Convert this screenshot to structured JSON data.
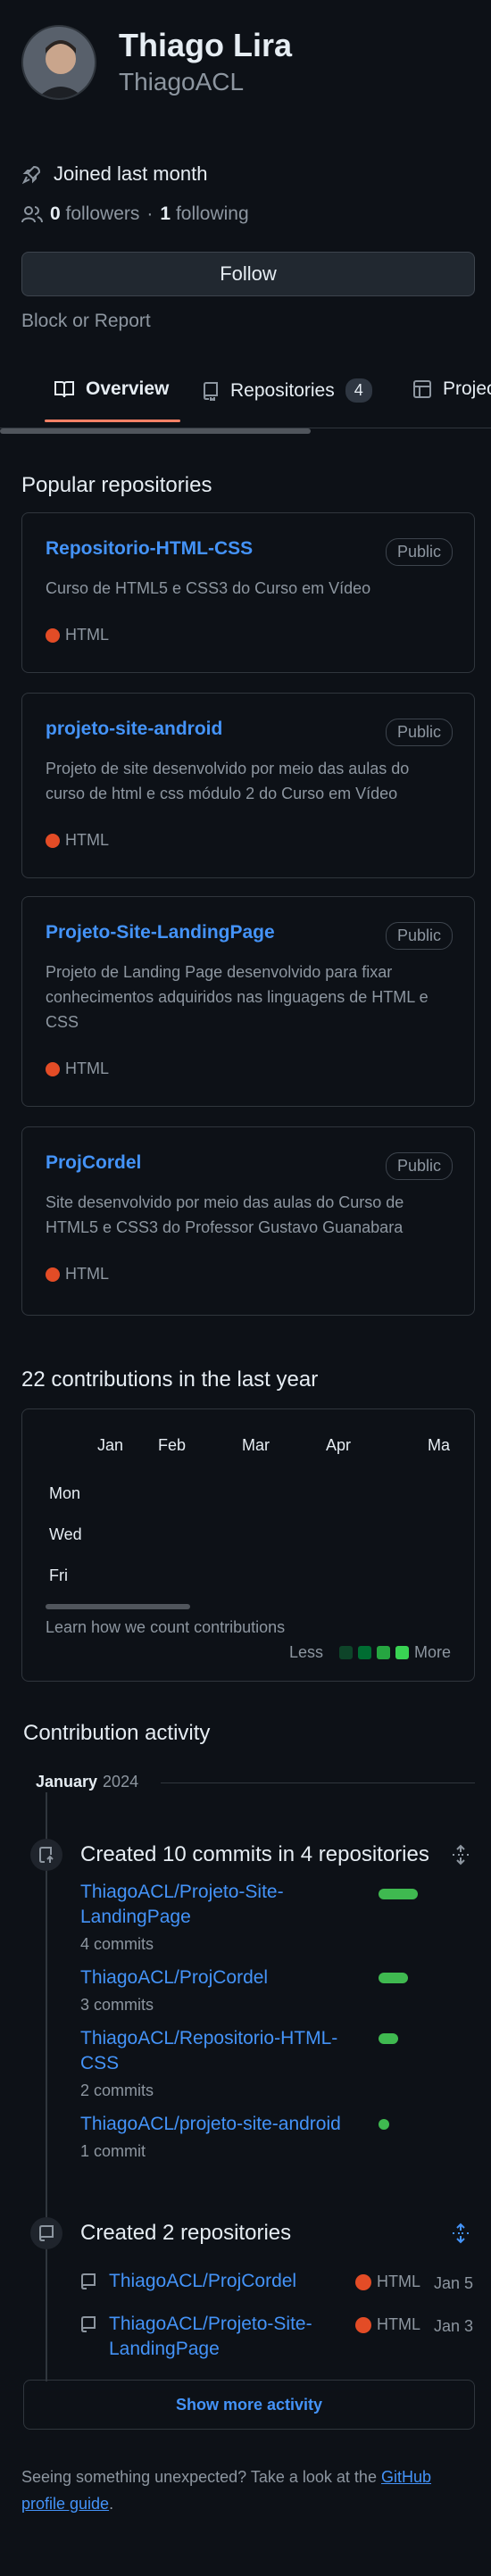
{
  "profile": {
    "name": "Thiago Lira",
    "login": "ThiagoACL",
    "joined": "Joined last month",
    "followers_count": "0",
    "followers_label": "followers",
    "separator": "·",
    "following_count": "1",
    "following_label": "following",
    "follow_button": "Follow",
    "block_report": "Block or Report"
  },
  "tabs": [
    {
      "label": "Overview",
      "icon": "book-icon",
      "selected": true
    },
    {
      "label": "Repositories",
      "icon": "repo-icon",
      "count": "4"
    },
    {
      "label": "Projects",
      "icon": "table-icon"
    }
  ],
  "popular": {
    "title": "Popular repositories",
    "repos": [
      {
        "name": "Repositorio-HTML-CSS",
        "visibility": "Public",
        "description": "Curso de HTML5 e CSS3 do Curso em Vídeo",
        "language": "HTML"
      },
      {
        "name": "projeto-site-android",
        "visibility": "Public",
        "description": "Projeto de site desenvolvido por meio das aulas do curso de html e css módulo 2 do Curso em Vídeo",
        "language": "HTML"
      },
      {
        "name": "Projeto-Site-LandingPage",
        "visibility": "Public",
        "description": "Projeto de Landing Page desenvolvido para fixar conhecimentos adquiridos nas linguagens de HTML e CSS",
        "language": "HTML"
      },
      {
        "name": "ProjCordel",
        "visibility": "Public",
        "description": "Site desenvolvido por meio das aulas do Curso de HTML5 e CSS3 do Professor Gustavo Guanabara",
        "language": "HTML"
      }
    ]
  },
  "contributions": {
    "title": "22 contributions in the last year",
    "months": [
      "Jan",
      "Feb",
      "Mar",
      "Apr",
      "Ma"
    ],
    "days": [
      "Mon",
      "Wed",
      "Fri"
    ],
    "learn": "Learn how we count contributions",
    "less": "Less",
    "more": "More",
    "legend_colors": [
      "#0e4429",
      "#006d32",
      "#26a641",
      "#39d353"
    ]
  },
  "activity": {
    "title": "Contribution activity",
    "month": "January",
    "year": "2024",
    "commits": {
      "title": "Created 10 commits in 4 repositories",
      "items": [
        {
          "repo": "ThiagoACL/Projeto-Site-LandingPage",
          "count": "4 commits",
          "share": 4
        },
        {
          "repo": "ThiagoACL/ProjCordel",
          "count": "3 commits",
          "share": 3
        },
        {
          "repo": "ThiagoACL/Repositorio-HTML-CSS",
          "count": "2 commits",
          "share": 2
        },
        {
          "repo": "ThiagoACL/projeto-site-android",
          "count": "1 commit",
          "share": 1
        }
      ]
    },
    "created": {
      "title": "Created 2 repositories",
      "items": [
        {
          "repo": "ThiagoACL/ProjCordel",
          "language": "HTML",
          "date": "Jan 5"
        },
        {
          "repo": "ThiagoACL/Projeto-Site-LandingPage",
          "language": "HTML",
          "date": "Jan 3"
        }
      ]
    },
    "show_more": "Show more activity"
  },
  "footer": {
    "text": "Seeing something unexpected? Take a look at the",
    "link": "GitHub profile guide",
    "end": "."
  },
  "colors": {
    "accent": "#4493f8",
    "html_lang": "#e34c26",
    "commit_bar": "#3fb950",
    "tab_underline": "#f78166"
  }
}
